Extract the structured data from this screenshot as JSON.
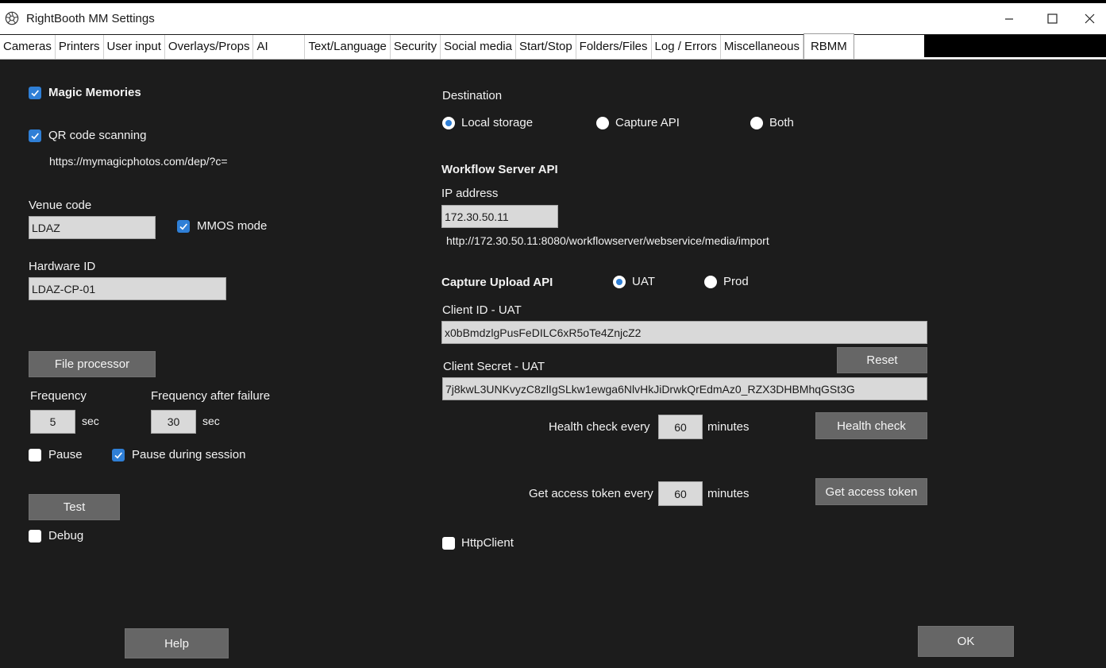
{
  "window": {
    "title": "RightBooth MM Settings",
    "icon": "aperture-icon"
  },
  "tabs": [
    "Cameras",
    "Printers",
    "User input",
    "Overlays/Props",
    "AI",
    "Text/Language",
    "Security",
    "Social media",
    "Start/Stop",
    "Folders/Files",
    "Log / Errors",
    "Miscellaneous",
    "RBMM"
  ],
  "active_tab": "RBMM",
  "left": {
    "magic_memories": {
      "label": "Magic Memories",
      "checked": true
    },
    "qr_scanning": {
      "label": "QR code scanning",
      "checked": true
    },
    "qr_url": "https://mymagicphotos.com/dep/?c=",
    "venue_code": {
      "label": "Venue code",
      "value": "LDAZ"
    },
    "mmos_mode": {
      "label": "MMOS mode",
      "checked": true
    },
    "hardware_id": {
      "label": "Hardware ID",
      "value": "LDAZ-CP-01"
    },
    "file_processor_button": "File processor",
    "frequency": {
      "label": "Frequency",
      "value": "5",
      "unit": "sec"
    },
    "frequency_after_failure": {
      "label": "Frequency after failure",
      "value": "30",
      "unit": "sec"
    },
    "pause": {
      "label": "Pause",
      "checked": false
    },
    "pause_during_session": {
      "label": "Pause during session",
      "checked": true
    },
    "test_button": "Test",
    "debug": {
      "label": "Debug",
      "checked": false
    },
    "help_button": "Help"
  },
  "right": {
    "destination": {
      "label": "Destination",
      "options": [
        "Local storage",
        "Capture API",
        "Both"
      ],
      "selected": "Local storage"
    },
    "workflow": {
      "heading": "Workflow Server API",
      "ip_label": "IP address",
      "ip_value": "172.30.50.11",
      "url": "http://172.30.50.11:8080/workflowserver/webservice/media/import"
    },
    "capture": {
      "heading": "Capture Upload API",
      "env_options": [
        "UAT",
        "Prod"
      ],
      "env_selected": "UAT",
      "client_id_label": "Client ID -  UAT",
      "client_id_value": "x0bBmdzlgPusFeDILC6xR5oTe4ZnjcZ2",
      "reset_button": "Reset",
      "client_secret_label": "Client Secret -  UAT",
      "client_secret_value": "7j8kwL3UNKvyzC8zlIgSLkw1ewga6NlvHkJiDrwkQrEdmAz0_RZX3DHBMhqGSt3G",
      "health_label": "Health check every",
      "health_value": "60",
      "health_unit": "minutes",
      "health_button": "Health check",
      "token_label": "Get access token every",
      "token_value": "60",
      "token_unit": "minutes",
      "token_button": "Get access token"
    },
    "httpclient": {
      "label": "HttpClient",
      "checked": false
    },
    "ok_button": "OK"
  },
  "colors": {
    "background": "#1c1c1c",
    "accent": "#2f7fd6",
    "button": "#666666",
    "input": "#d9d9d9"
  }
}
